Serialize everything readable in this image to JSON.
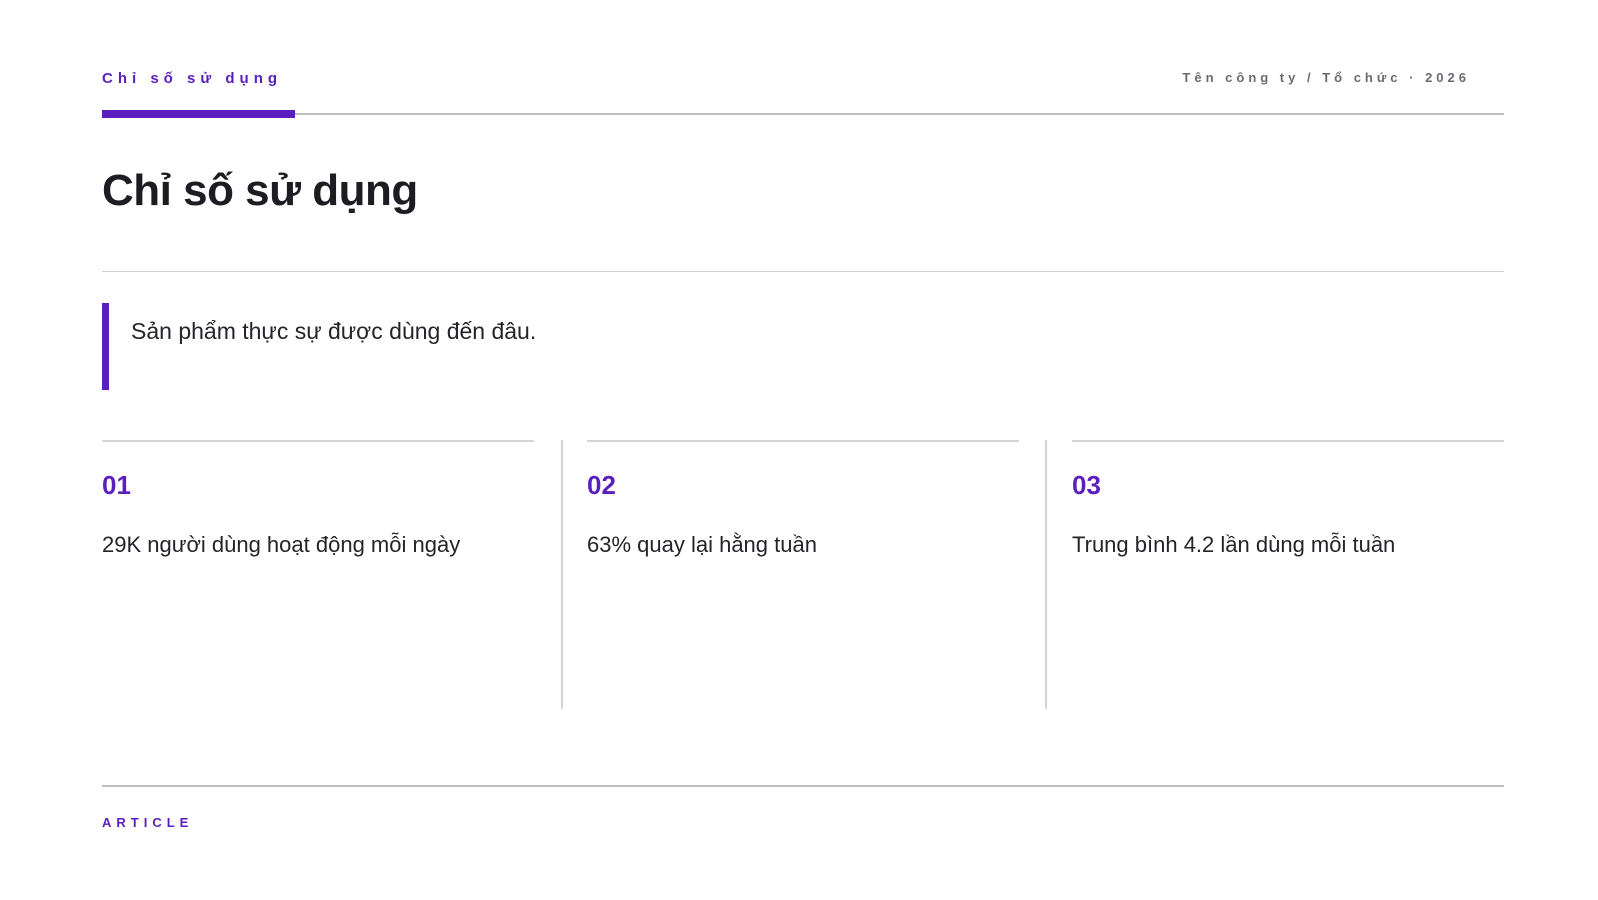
{
  "header": {
    "section_label": "Chỉ số sử dụng",
    "organization": "Tên công ty / Tổ chức · 2026"
  },
  "main": {
    "title": "Chỉ số sử dụng",
    "subtitle": "Sản phẩm thực sự được dùng đến đâu.",
    "cards": [
      {
        "number": "01",
        "text": "29K người dùng hoạt động mỗi ngày"
      },
      {
        "number": "02",
        "text": "63% quay lại hằng tuần"
      },
      {
        "number": "03",
        "text": "Trung bình 4.2 lần dùng mỗi tuần"
      }
    ]
  },
  "footer": {
    "label": "ARTICLE"
  },
  "colors": {
    "accent": "#5b1fbf",
    "text": "#1c1c22",
    "muted": "#6a6a72",
    "rule": "#bdbdc3"
  }
}
